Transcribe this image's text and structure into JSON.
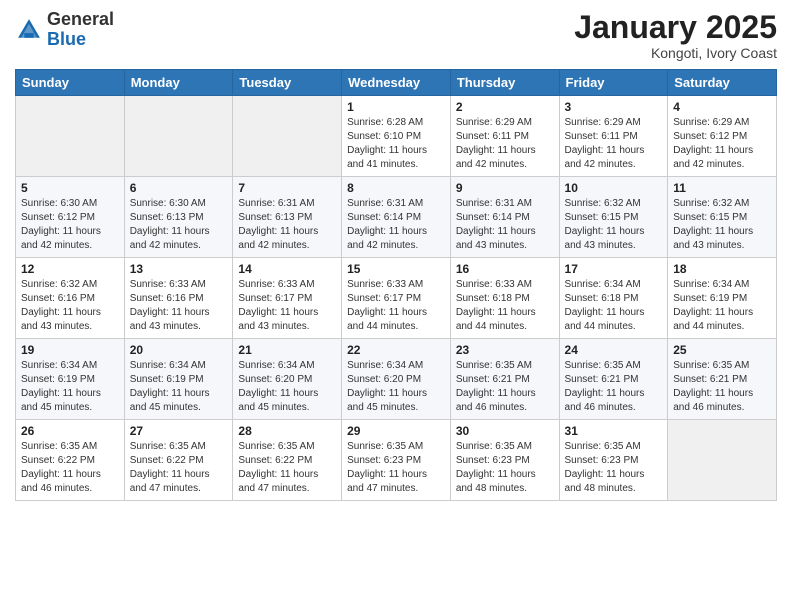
{
  "header": {
    "logo_general": "General",
    "logo_blue": "Blue",
    "month_year": "January 2025",
    "location": "Kongoti, Ivory Coast"
  },
  "days_of_week": [
    "Sunday",
    "Monday",
    "Tuesday",
    "Wednesday",
    "Thursday",
    "Friday",
    "Saturday"
  ],
  "weeks": [
    [
      {
        "num": "",
        "sunrise": "",
        "sunset": "",
        "daylight": ""
      },
      {
        "num": "",
        "sunrise": "",
        "sunset": "",
        "daylight": ""
      },
      {
        "num": "",
        "sunrise": "",
        "sunset": "",
        "daylight": ""
      },
      {
        "num": "1",
        "sunrise": "Sunrise: 6:28 AM",
        "sunset": "Sunset: 6:10 PM",
        "daylight": "Daylight: 11 hours and 41 minutes."
      },
      {
        "num": "2",
        "sunrise": "Sunrise: 6:29 AM",
        "sunset": "Sunset: 6:11 PM",
        "daylight": "Daylight: 11 hours and 42 minutes."
      },
      {
        "num": "3",
        "sunrise": "Sunrise: 6:29 AM",
        "sunset": "Sunset: 6:11 PM",
        "daylight": "Daylight: 11 hours and 42 minutes."
      },
      {
        "num": "4",
        "sunrise": "Sunrise: 6:29 AM",
        "sunset": "Sunset: 6:12 PM",
        "daylight": "Daylight: 11 hours and 42 minutes."
      }
    ],
    [
      {
        "num": "5",
        "sunrise": "Sunrise: 6:30 AM",
        "sunset": "Sunset: 6:12 PM",
        "daylight": "Daylight: 11 hours and 42 minutes."
      },
      {
        "num": "6",
        "sunrise": "Sunrise: 6:30 AM",
        "sunset": "Sunset: 6:13 PM",
        "daylight": "Daylight: 11 hours and 42 minutes."
      },
      {
        "num": "7",
        "sunrise": "Sunrise: 6:31 AM",
        "sunset": "Sunset: 6:13 PM",
        "daylight": "Daylight: 11 hours and 42 minutes."
      },
      {
        "num": "8",
        "sunrise": "Sunrise: 6:31 AM",
        "sunset": "Sunset: 6:14 PM",
        "daylight": "Daylight: 11 hours and 42 minutes."
      },
      {
        "num": "9",
        "sunrise": "Sunrise: 6:31 AM",
        "sunset": "Sunset: 6:14 PM",
        "daylight": "Daylight: 11 hours and 43 minutes."
      },
      {
        "num": "10",
        "sunrise": "Sunrise: 6:32 AM",
        "sunset": "Sunset: 6:15 PM",
        "daylight": "Daylight: 11 hours and 43 minutes."
      },
      {
        "num": "11",
        "sunrise": "Sunrise: 6:32 AM",
        "sunset": "Sunset: 6:15 PM",
        "daylight": "Daylight: 11 hours and 43 minutes."
      }
    ],
    [
      {
        "num": "12",
        "sunrise": "Sunrise: 6:32 AM",
        "sunset": "Sunset: 6:16 PM",
        "daylight": "Daylight: 11 hours and 43 minutes."
      },
      {
        "num": "13",
        "sunrise": "Sunrise: 6:33 AM",
        "sunset": "Sunset: 6:16 PM",
        "daylight": "Daylight: 11 hours and 43 minutes."
      },
      {
        "num": "14",
        "sunrise": "Sunrise: 6:33 AM",
        "sunset": "Sunset: 6:17 PM",
        "daylight": "Daylight: 11 hours and 43 minutes."
      },
      {
        "num": "15",
        "sunrise": "Sunrise: 6:33 AM",
        "sunset": "Sunset: 6:17 PM",
        "daylight": "Daylight: 11 hours and 44 minutes."
      },
      {
        "num": "16",
        "sunrise": "Sunrise: 6:33 AM",
        "sunset": "Sunset: 6:18 PM",
        "daylight": "Daylight: 11 hours and 44 minutes."
      },
      {
        "num": "17",
        "sunrise": "Sunrise: 6:34 AM",
        "sunset": "Sunset: 6:18 PM",
        "daylight": "Daylight: 11 hours and 44 minutes."
      },
      {
        "num": "18",
        "sunrise": "Sunrise: 6:34 AM",
        "sunset": "Sunset: 6:19 PM",
        "daylight": "Daylight: 11 hours and 44 minutes."
      }
    ],
    [
      {
        "num": "19",
        "sunrise": "Sunrise: 6:34 AM",
        "sunset": "Sunset: 6:19 PM",
        "daylight": "Daylight: 11 hours and 45 minutes."
      },
      {
        "num": "20",
        "sunrise": "Sunrise: 6:34 AM",
        "sunset": "Sunset: 6:19 PM",
        "daylight": "Daylight: 11 hours and 45 minutes."
      },
      {
        "num": "21",
        "sunrise": "Sunrise: 6:34 AM",
        "sunset": "Sunset: 6:20 PM",
        "daylight": "Daylight: 11 hours and 45 minutes."
      },
      {
        "num": "22",
        "sunrise": "Sunrise: 6:34 AM",
        "sunset": "Sunset: 6:20 PM",
        "daylight": "Daylight: 11 hours and 45 minutes."
      },
      {
        "num": "23",
        "sunrise": "Sunrise: 6:35 AM",
        "sunset": "Sunset: 6:21 PM",
        "daylight": "Daylight: 11 hours and 46 minutes."
      },
      {
        "num": "24",
        "sunrise": "Sunrise: 6:35 AM",
        "sunset": "Sunset: 6:21 PM",
        "daylight": "Daylight: 11 hours and 46 minutes."
      },
      {
        "num": "25",
        "sunrise": "Sunrise: 6:35 AM",
        "sunset": "Sunset: 6:21 PM",
        "daylight": "Daylight: 11 hours and 46 minutes."
      }
    ],
    [
      {
        "num": "26",
        "sunrise": "Sunrise: 6:35 AM",
        "sunset": "Sunset: 6:22 PM",
        "daylight": "Daylight: 11 hours and 46 minutes."
      },
      {
        "num": "27",
        "sunrise": "Sunrise: 6:35 AM",
        "sunset": "Sunset: 6:22 PM",
        "daylight": "Daylight: 11 hours and 47 minutes."
      },
      {
        "num": "28",
        "sunrise": "Sunrise: 6:35 AM",
        "sunset": "Sunset: 6:22 PM",
        "daylight": "Daylight: 11 hours and 47 minutes."
      },
      {
        "num": "29",
        "sunrise": "Sunrise: 6:35 AM",
        "sunset": "Sunset: 6:23 PM",
        "daylight": "Daylight: 11 hours and 47 minutes."
      },
      {
        "num": "30",
        "sunrise": "Sunrise: 6:35 AM",
        "sunset": "Sunset: 6:23 PM",
        "daylight": "Daylight: 11 hours and 48 minutes."
      },
      {
        "num": "31",
        "sunrise": "Sunrise: 6:35 AM",
        "sunset": "Sunset: 6:23 PM",
        "daylight": "Daylight: 11 hours and 48 minutes."
      },
      {
        "num": "",
        "sunrise": "",
        "sunset": "",
        "daylight": ""
      }
    ]
  ]
}
